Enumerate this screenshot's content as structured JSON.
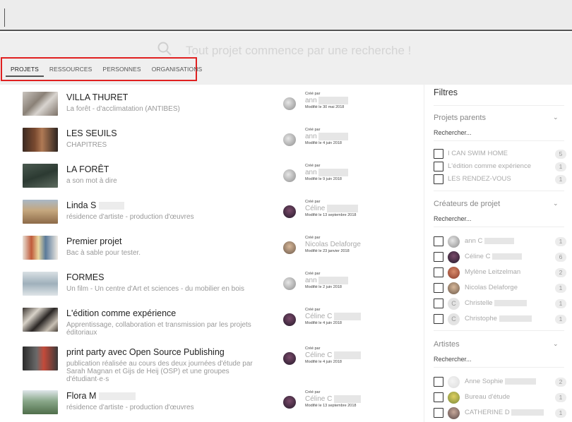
{
  "search": {
    "placeholder": "Tout projet commence par une recherche !"
  },
  "tabs": [
    {
      "label": "PROJETS",
      "active": true
    },
    {
      "label": "RESSOURCES",
      "active": false
    },
    {
      "label": "PERSONNES",
      "active": false
    },
    {
      "label": "ORGANISATIONS",
      "active": false
    }
  ],
  "projects": [
    {
      "title": "VILLA THURET",
      "subtitle": "La forêt - d'acclimatation (ANTIBES)",
      "created_by_label": "Créé par",
      "creator": "ann",
      "modified": "Modifié le 30 mai 2018"
    },
    {
      "title": "LES SEUILS",
      "subtitle": "CHAPITRES",
      "created_by_label": "Créé par",
      "creator": "ann",
      "modified": "Modifié le 4 juin 2018"
    },
    {
      "title": "LA FORÊT",
      "subtitle": "a son mot à dire",
      "created_by_label": "Créé par",
      "creator": "ann",
      "modified": "Modifié le 9 juin 2018"
    },
    {
      "title": "Linda S",
      "subtitle": "résidence d'artiste - production d'œuvres",
      "created_by_label": "Créé par",
      "creator": "Céline",
      "modified": "Modifié le 13 septembre 2018"
    },
    {
      "title": "Premier projet",
      "subtitle": "Bac à sable pour tester.",
      "created_by_label": "Créé par",
      "creator": "Nicolas Delaforge",
      "modified": "Modifié le 23 janvier 2018"
    },
    {
      "title": "FORMES",
      "subtitle": "Un film - Un centre d'Art et sciences - du mobilier en bois",
      "created_by_label": "Créé par",
      "creator": "ann",
      "modified": "Modifié le 2 juin 2018"
    },
    {
      "title": "L'édition comme expérience",
      "subtitle": "Apprentissage, collaboration et transmission par les projets éditoriaux",
      "created_by_label": "Créé par",
      "creator": "Céline C",
      "modified": "Modifié le 4 juin 2018"
    },
    {
      "title": "print party avec Open Source Publishing",
      "subtitle": "publication réalisée au cours des deux journées d'étude par Sarah Magnan et Gijs de Heij (OSP) et une groupes d'étudiant·e·s",
      "created_by_label": "Créé par",
      "creator": "Céline C",
      "modified": "Modifié le 4 juin 2018"
    },
    {
      "title": "Flora M",
      "subtitle": "résidence d'artiste - production d'œuvres",
      "created_by_label": "Créé par",
      "creator": "Céline C",
      "modified": "Modifié le 13 septembre 2018"
    }
  ],
  "filters": {
    "title": "Filtres",
    "sections": [
      {
        "title": "Projets parents",
        "search_label": "Rechercher...",
        "items": [
          {
            "label": "I CAN SWIM HOME",
            "count": "5"
          },
          {
            "label": "L'édition comme expérience",
            "count": "1"
          },
          {
            "label": "LES RENDEZ-VOUS",
            "count": "1"
          }
        ]
      },
      {
        "title": "Créateurs de projet",
        "search_label": "Rechercher...",
        "items": [
          {
            "label": "ann C",
            "count": "1"
          },
          {
            "label": "Céline C",
            "count": "6"
          },
          {
            "label": "Mylène Leitzelman",
            "count": "2"
          },
          {
            "label": "Nicolas Delaforge",
            "count": "1"
          },
          {
            "label": "Christelle",
            "count": "1",
            "initial": "C"
          },
          {
            "label": "Christophe",
            "count": "1",
            "initial": "C"
          }
        ]
      },
      {
        "title": "Artistes",
        "search_label": "Rechercher...",
        "items": [
          {
            "label": "Anne Sophie",
            "count": "2"
          },
          {
            "label": "Bureau d'étude",
            "count": "1"
          },
          {
            "label": "CATHERINE D",
            "count": "1"
          }
        ]
      }
    ]
  },
  "colors": {
    "highlight_box": "#e02020",
    "background_gray": "#efefef"
  }
}
